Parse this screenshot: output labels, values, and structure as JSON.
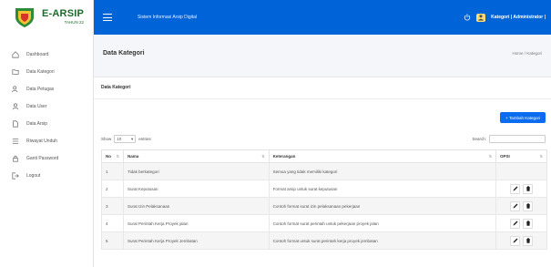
{
  "brand": {
    "name": "E-ARSIP",
    "sub": "TAHUN 22"
  },
  "sidebar": {
    "items": [
      {
        "label": "Dashboard",
        "icon": "home-icon"
      },
      {
        "label": "Data Kategori",
        "icon": "folder-icon"
      },
      {
        "label": "Data Petugas",
        "icon": "users-icon"
      },
      {
        "label": "Data User",
        "icon": "user-icon"
      },
      {
        "label": "Data Arsip",
        "icon": "file-icon"
      },
      {
        "label": "Riwayat Unduh",
        "icon": "list-icon"
      },
      {
        "label": "Ganti Password",
        "icon": "lock-icon"
      },
      {
        "label": "Logout",
        "icon": "logout-icon"
      }
    ]
  },
  "header": {
    "app_title": "Sistem Informasi Arsip Digital",
    "user_label": "Kategori | Administrator |",
    "accent": "#0064d9"
  },
  "page": {
    "title": "Data Kategori",
    "breadcrumb": "Home / Kategori"
  },
  "card": {
    "title": "Data Kategori",
    "add_button": "+ Tambah Kategori",
    "show_label": "Show",
    "length_value": "10",
    "entries_label": "entries",
    "search_label": "Search:",
    "search_value": ""
  },
  "table": {
    "headers": [
      "No",
      "Nama",
      "Keterangan",
      "OPSI"
    ],
    "rows": [
      {
        "no": "1",
        "nama": "Tidak berkategori",
        "keterangan": "Semua yang tidak memiliki kategori"
      },
      {
        "no": "2",
        "nama": "Surat Keputusan",
        "keterangan": "Format arsip untuk surat keputusan"
      },
      {
        "no": "3",
        "nama": "Surat Izin Pelaksanaan",
        "keterangan": "Contoh format surat izin pelaksanaan pekerjaan"
      },
      {
        "no": "4",
        "nama": "Surat Perintah Kerja Proyek jalan",
        "keterangan": "Contoh format surat perintah untuk pekerjaan proyek jalan"
      },
      {
        "no": "5",
        "nama": "Surat Perintah Kerja Proyek Jembatan",
        "keterangan": "Contoh format untuk surat perintah kerja proyek jembatan"
      }
    ]
  }
}
